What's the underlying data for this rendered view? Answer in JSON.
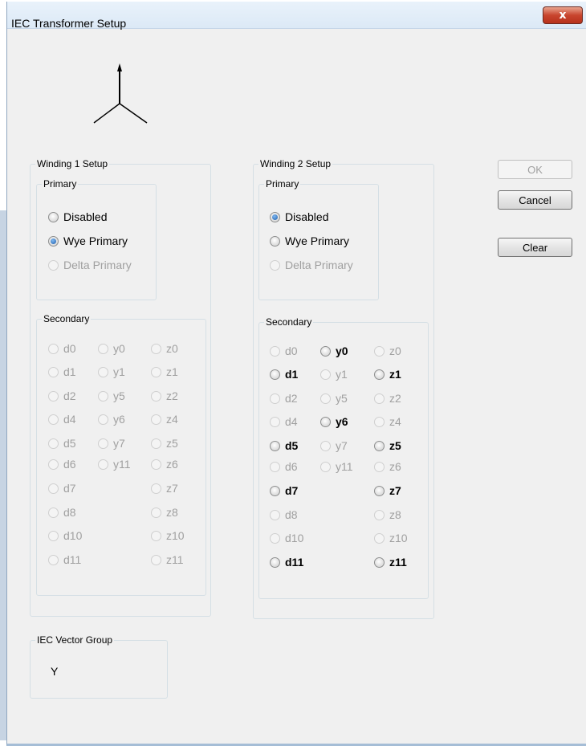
{
  "window": {
    "title": "IEC Transformer Setup",
    "close_symbol": "x"
  },
  "icon": "wye-symbol-icon",
  "winding1": {
    "title": "Winding 1 Setup",
    "primary": {
      "title": "Primary",
      "options": [
        {
          "label": "Disabled",
          "checked": false,
          "disabled": false
        },
        {
          "label": "Wye Primary",
          "checked": true,
          "disabled": false
        },
        {
          "label": "Delta Primary",
          "checked": false,
          "disabled": true
        }
      ]
    },
    "secondary": {
      "title": "Secondary",
      "col1": [
        "d0",
        "d1",
        "d2",
        "d4",
        "d5",
        "d6",
        "d7",
        "d8",
        "d10",
        "d11"
      ],
      "col2": [
        "y0",
        "y1",
        "y5",
        "y6",
        "y7",
        "y11"
      ],
      "col3": [
        "z0",
        "z1",
        "z2",
        "z4",
        "z5",
        "z6",
        "z7",
        "z8",
        "z10",
        "z11"
      ]
    }
  },
  "winding2": {
    "title": "Winding 2 Setup",
    "primary": {
      "title": "Primary",
      "options": [
        {
          "label": "Disabled",
          "checked": true,
          "disabled": false
        },
        {
          "label": "Wye Primary",
          "checked": false,
          "disabled": false
        },
        {
          "label": "Delta Primary",
          "checked": false,
          "disabled": true
        }
      ]
    },
    "secondary": {
      "title": "Secondary",
      "col1": [
        "d0",
        "d1",
        "d2",
        "d4",
        "d5",
        "d6",
        "d7",
        "d8",
        "d10",
        "d11"
      ],
      "col2": [
        "y0",
        "y1",
        "y5",
        "y6",
        "y7",
        "y11"
      ],
      "col3": [
        "z0",
        "z1",
        "z2",
        "z4",
        "z5",
        "z6",
        "z7",
        "z8",
        "z10",
        "z11"
      ],
      "enabled": [
        "d1",
        "d5",
        "d7",
        "d11",
        "y0",
        "y6",
        "z1",
        "z5",
        "z7",
        "z11"
      ]
    }
  },
  "buttons": {
    "ok": "OK",
    "cancel": "Cancel",
    "clear": "Clear"
  },
  "vector_group": {
    "title": "IEC Vector Group",
    "value": "Y"
  }
}
